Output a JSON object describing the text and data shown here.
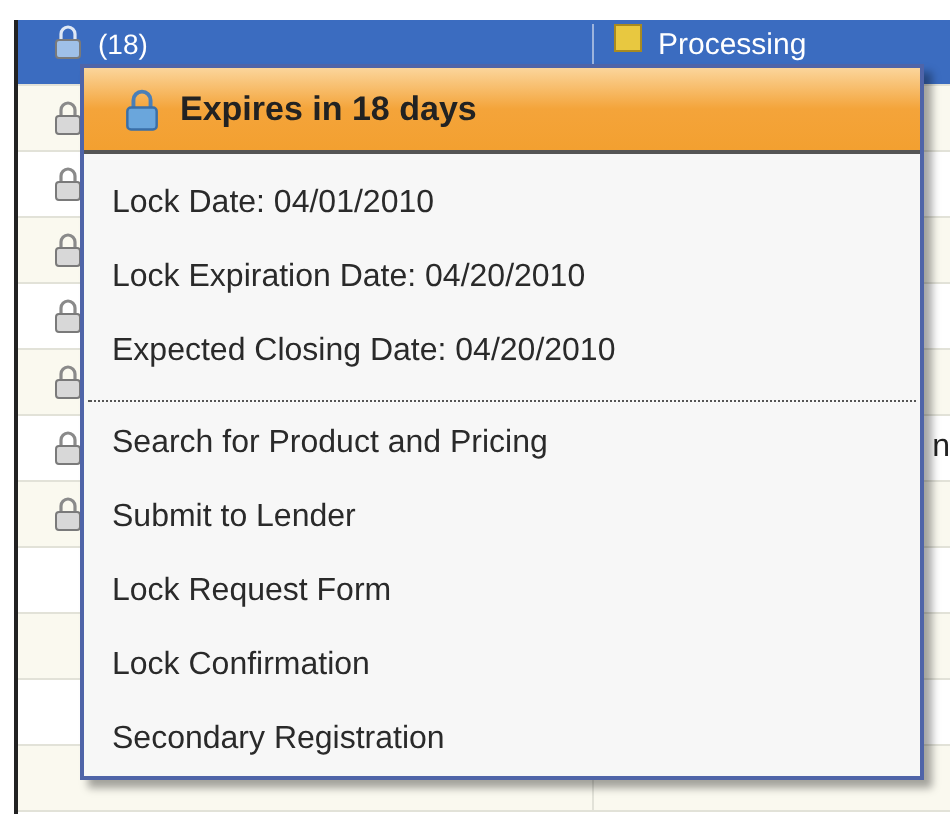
{
  "table": {
    "rows": [
      {
        "selected": true,
        "locked": true,
        "column_1": "(18)",
        "status": "Processing"
      },
      {
        "selected": false,
        "locked": true
      },
      {
        "selected": false,
        "locked": true
      },
      {
        "selected": false,
        "locked": true
      },
      {
        "selected": false,
        "locked": true
      },
      {
        "selected": false,
        "locked": true
      },
      {
        "selected": false,
        "locked": true,
        "column_2": "n"
      },
      {
        "selected": false,
        "locked": true
      },
      {
        "selected": false,
        "locked": false
      },
      {
        "selected": false,
        "locked": false
      },
      {
        "selected": false,
        "locked": false
      },
      {
        "selected": false,
        "locked": false
      }
    ]
  },
  "popup": {
    "header": "Expires in 18 days",
    "details": [
      "Lock Date: 04/01/2010",
      "Lock Expiration Date: 04/20/2010",
      "Expected Closing Date: 04/20/2010"
    ],
    "actions": [
      "Search for Product and Pricing",
      "Submit to Lender",
      "Lock Request Form",
      "Lock Confirmation",
      "Secondary Registration"
    ]
  }
}
